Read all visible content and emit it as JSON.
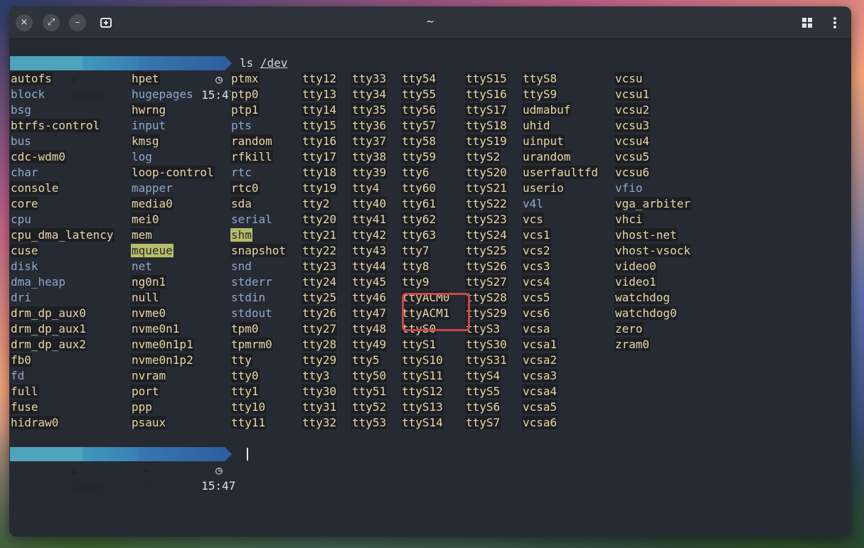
{
  "window": {
    "title": "~",
    "buttons": {
      "close": "×",
      "restore": "⤢",
      "minimize": "–",
      "new_tab": "+"
    }
  },
  "prompt": {
    "user": "jason",
    "dir": "~",
    "time": "15:47",
    "arch_icon": "arch-logo-icon",
    "folder_icon": "folder-open-icon",
    "clock_icon": "clock-icon"
  },
  "command": {
    "name": "ls",
    "arg": "/dev"
  },
  "columns": [
    [
      "autofs",
      "block",
      "bsg",
      "btrfs-control",
      "bus",
      "cdc-wdm0",
      "char",
      "console",
      "core",
      "cpu",
      "cpu_dma_latency",
      "cuse",
      "disk",
      "dma_heap",
      "dri",
      "drm_dp_aux0",
      "drm_dp_aux1",
      "drm_dp_aux2",
      "fb0",
      "fd",
      "full",
      "fuse",
      "hidraw0"
    ],
    [
      "hpet",
      "hugepages",
      "hwrng",
      "input",
      "kmsg",
      "log",
      "loop-control",
      "mapper",
      "media0",
      "mei0",
      "mem",
      "mqueue",
      "net",
      "ng0n1",
      "null",
      "nvme0",
      "nvme0n1",
      "nvme0n1p1",
      "nvme0n1p2",
      "nvram",
      "port",
      "ppp",
      "psaux"
    ],
    [
      "ptmx",
      "ptp0",
      "ptp1",
      "pts",
      "random",
      "rfkill",
      "rtc",
      "rtc0",
      "sda",
      "serial",
      "shm",
      "snapshot",
      "snd",
      "stderr",
      "stdin",
      "stdout",
      "tpm0",
      "tpmrm0",
      "tty",
      "tty0",
      "tty1",
      "tty10",
      "tty11"
    ],
    [
      "tty12",
      "tty13",
      "tty14",
      "tty15",
      "tty16",
      "tty17",
      "tty18",
      "tty19",
      "tty2",
      "tty20",
      "tty21",
      "tty22",
      "tty23",
      "tty24",
      "tty25",
      "tty26",
      "tty27",
      "tty28",
      "tty29",
      "tty3",
      "tty30",
      "tty31",
      "tty32"
    ],
    [
      "tty33",
      "tty34",
      "tty35",
      "tty36",
      "tty37",
      "tty38",
      "tty39",
      "tty4",
      "tty40",
      "tty41",
      "tty42",
      "tty43",
      "tty44",
      "tty45",
      "tty46",
      "tty47",
      "tty48",
      "tty49",
      "tty5",
      "tty50",
      "tty51",
      "tty52",
      "tty53"
    ],
    [
      "tty54",
      "tty55",
      "tty56",
      "tty57",
      "tty58",
      "tty59",
      "tty6",
      "tty60",
      "tty61",
      "tty62",
      "tty63",
      "tty7",
      "tty8",
      "tty9",
      "ttyACM0",
      "ttyACM1",
      "ttyS0",
      "ttyS1",
      "ttyS10",
      "ttyS11",
      "ttyS12",
      "ttyS13",
      "ttyS14"
    ],
    [
      "ttyS15",
      "ttyS16",
      "ttyS17",
      "ttyS18",
      "ttyS19",
      "ttyS2",
      "ttyS20",
      "ttyS21",
      "ttyS22",
      "ttyS23",
      "ttyS24",
      "ttyS25",
      "ttyS26",
      "ttyS27",
      "ttyS28",
      "ttyS29",
      "ttyS3",
      "ttyS30",
      "ttyS31",
      "ttyS4",
      "ttyS5",
      "ttyS6",
      "ttyS7"
    ],
    [
      "ttyS8",
      "ttyS9",
      "udmabuf",
      "uhid",
      "uinput",
      "urandom",
      "userfaultfd",
      "userio",
      "v4l",
      "vcs",
      "vcs1",
      "vcs2",
      "vcs3",
      "vcs4",
      "vcs5",
      "vcs6",
      "vcsa",
      "vcsa1",
      "vcsa2",
      "vcsa3",
      "vcsa4",
      "vcsa5",
      "vcsa6"
    ],
    [
      "vcsu",
      "vcsu1",
      "vcsu2",
      "vcsu3",
      "vcsu4",
      "vcsu5",
      "vcsu6",
      "vfio",
      "vga_arbiter",
      "vhci",
      "vhost-net",
      "vhost-vsock",
      "video0",
      "video1",
      "watchdog",
      "watchdog0",
      "zero",
      "zram0"
    ]
  ],
  "directories": [
    "block",
    "bsg",
    "bus",
    "char",
    "cpu",
    "disk",
    "dma_heap",
    "dri",
    "fd",
    "hugepages",
    "input",
    "log",
    "mapper",
    "net",
    "pts",
    "rtc",
    "serial",
    "snd",
    "stderr",
    "stdin",
    "stdout",
    "v4l",
    "vfio"
  ],
  "highlighted_dirs": [
    "mqueue",
    "shm"
  ],
  "colors": {
    "terminal_bg": "#262a33",
    "device_text": "#e6d6a9",
    "dir_text": "#8ea9c9",
    "highlight_bg": "#b8bd67",
    "annotation": "#c9474b"
  },
  "annotation": {
    "marks": [
      "ttyACM0",
      "ttyACM1"
    ]
  }
}
